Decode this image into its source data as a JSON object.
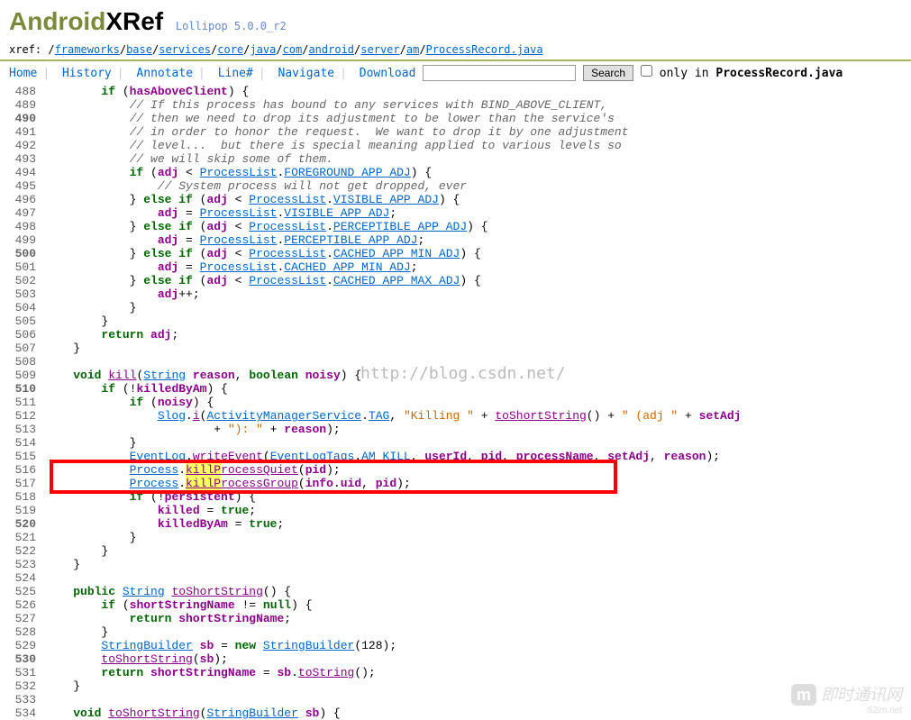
{
  "logo": {
    "android": "Android",
    "xref": "XRef",
    "version": "Lollipop 5.0.0_r2"
  },
  "breadcrumb": {
    "prefix": "xref: ",
    "parts": [
      "frameworks",
      "base",
      "services",
      "core",
      "java",
      "com",
      "android",
      "server",
      "am",
      "ProcessRecord.java"
    ]
  },
  "nav": {
    "home": "Home",
    "history": "History",
    "annotate": "Annotate",
    "line": "Line#",
    "navigate": "Navigate",
    "download": "Download",
    "search": "Search",
    "only_in": " only in ",
    "file": "ProcessRecord.java"
  },
  "watermark": "http://blog.csdn.net/",
  "bottom_wm": {
    "m": "m",
    "text": "即时通讯网",
    "sub": "52im.net"
  },
  "lines": [
    {
      "n": "488",
      "cls": "",
      "html": "        <span class='kw'>if</span> (<span class='var'>hasAboveClient</span>) {"
    },
    {
      "n": "489",
      "cls": "",
      "html": "            <span class='cmt'>// If this process has bound to any services with BIND_ABOVE_CLIENT,</span>"
    },
    {
      "n": "490",
      "cls": "curr",
      "html": "            <span class='cmt'>// then we need to drop its adjustment to be lower than the service's</span>"
    },
    {
      "n": "491",
      "cls": "",
      "html": "            <span class='cmt'>// in order to honor the request.  We want to drop it by one adjustment</span>"
    },
    {
      "n": "492",
      "cls": "",
      "html": "            <span class='cmt'>// level...  but there is special meaning applied to various levels so</span>"
    },
    {
      "n": "493",
      "cls": "",
      "html": "            <span class='cmt'>// we will skip some of them.</span>"
    },
    {
      "n": "494",
      "cls": "",
      "html": "            <span class='kw'>if</span> (<span class='var'>adj</span> &lt; <span class='type'>ProcessList</span>.<span class='type'>FOREGROUND_APP_ADJ</span>) {"
    },
    {
      "n": "495",
      "cls": "",
      "html": "                <span class='cmt'>// System process will not get dropped, ever</span>"
    },
    {
      "n": "496",
      "cls": "",
      "html": "            } <span class='kw'>else</span> <span class='kw'>if</span> (<span class='var'>adj</span> &lt; <span class='type'>ProcessList</span>.<span class='type'>VISIBLE_APP_ADJ</span>) {"
    },
    {
      "n": "497",
      "cls": "",
      "html": "                <span class='var'>adj</span> = <span class='type'>ProcessList</span>.<span class='type'>VISIBLE_APP_ADJ</span>;"
    },
    {
      "n": "498",
      "cls": "",
      "html": "            } <span class='kw'>else</span> <span class='kw'>if</span> (<span class='var'>adj</span> &lt; <span class='type'>ProcessList</span>.<span class='type'>PERCEPTIBLE_APP_ADJ</span>) {"
    },
    {
      "n": "499",
      "cls": "",
      "html": "                <span class='var'>adj</span> = <span class='type'>ProcessList</span>.<span class='type'>PERCEPTIBLE_APP_ADJ</span>;"
    },
    {
      "n": "500",
      "cls": "curr",
      "html": "            } <span class='kw'>else</span> <span class='kw'>if</span> (<span class='var'>adj</span> &lt; <span class='type'>ProcessList</span>.<span class='type'>CACHED_APP_MIN_ADJ</span>) {"
    },
    {
      "n": "501",
      "cls": "",
      "html": "                <span class='var'>adj</span> = <span class='type'>ProcessList</span>.<span class='type'>CACHED_APP_MIN_ADJ</span>;"
    },
    {
      "n": "502",
      "cls": "",
      "html": "            } <span class='kw'>else</span> <span class='kw'>if</span> (<span class='var'>adj</span> &lt; <span class='type'>ProcessList</span>.<span class='type'>CACHED_APP_MAX_ADJ</span>) {"
    },
    {
      "n": "503",
      "cls": "",
      "html": "                <span class='var'>adj</span>++;"
    },
    {
      "n": "504",
      "cls": "",
      "html": "            }"
    },
    {
      "n": "505",
      "cls": "",
      "html": "        }"
    },
    {
      "n": "506",
      "cls": "",
      "html": "        <span class='kw'>return</span> <span class='var'>adj</span>;"
    },
    {
      "n": "507",
      "cls": "",
      "html": "    }"
    },
    {
      "n": "508",
      "cls": "",
      "html": ""
    },
    {
      "n": "509",
      "cls": "",
      "html": "    <span class='kw'>void</span> <span class='fn'>kill</span>(<span class='type'>String</span> <span class='var'>reason</span>, <span class='kw'>boolean</span> <span class='var'>noisy</span>) {"
    },
    {
      "n": "510",
      "cls": "curr",
      "html": "        <span class='kw'>if</span> (!<span class='var'>killedByAm</span>) {"
    },
    {
      "n": "511",
      "cls": "",
      "html": "            <span class='kw'>if</span> (<span class='var'>noisy</span>) {"
    },
    {
      "n": "512",
      "cls": "",
      "html": "                <span class='type'>Slog</span>.<span class='fn'>i</span>(<span class='type'>ActivityManagerService</span>.<span class='type'>TAG</span>, <span class='str'>\"Killing \"</span> + <span class='fn'>toShortString</span>() + <span class='str'>\" (adj \"</span> + <span class='var'>setAdj</span>"
    },
    {
      "n": "513",
      "cls": "",
      "html": "                        + <span class='str'>\"): \"</span> + <span class='var'>reason</span>);"
    },
    {
      "n": "514",
      "cls": "",
      "html": "            }"
    },
    {
      "n": "515",
      "cls": "",
      "html": "            <span class='type'>EventLog</span>.<span class='fn'>writeEvent</span>(<span class='type'>EventLogTags</span>.<span class='type'>AM_KILL</span>, <span class='var'>userId</span>, <span class='var'>pid</span>, <span class='var'>processName</span>, <span class='var'>setAdj</span>, <span class='var'>reason</span>);"
    },
    {
      "n": "516",
      "cls": "",
      "html": "            <span class='type'>Process</span>.<span class='fn'><span class='hl'>killP</span>rocessQuiet</span>(<span class='var'>pid</span>);"
    },
    {
      "n": "517",
      "cls": "",
      "html": "            <span class='type'>Process</span>.<span class='fn'><span class='hl'>killP</span>rocessGroup</span>(<span class='var'>info</span>.<span class='var'>uid</span>, <span class='var'>pid</span>);"
    },
    {
      "n": "518",
      "cls": "",
      "html": "            <span class='kw'>if</span> (!<span class='var'>persistent</span>) {"
    },
    {
      "n": "519",
      "cls": "",
      "html": "                <span class='var'>killed</span> = <span class='kw'>true</span>;"
    },
    {
      "n": "520",
      "cls": "curr",
      "html": "                <span class='var'>killedByAm</span> = <span class='kw'>true</span>;"
    },
    {
      "n": "521",
      "cls": "",
      "html": "            }"
    },
    {
      "n": "522",
      "cls": "",
      "html": "        }"
    },
    {
      "n": "523",
      "cls": "",
      "html": "    }"
    },
    {
      "n": "524",
      "cls": "",
      "html": ""
    },
    {
      "n": "525",
      "cls": "",
      "html": "    <span class='kw'>public</span> <span class='type'>String</span> <span class='fn'>toShortString</span>() {"
    },
    {
      "n": "526",
      "cls": "",
      "html": "        <span class='kw'>if</span> (<span class='var'>shortStringName</span> != <span class='kw'>null</span>) {"
    },
    {
      "n": "527",
      "cls": "",
      "html": "            <span class='kw'>return</span> <span class='var'>shortStringName</span>;"
    },
    {
      "n": "528",
      "cls": "",
      "html": "        }"
    },
    {
      "n": "529",
      "cls": "",
      "html": "        <span class='type'>StringBuilder</span> <span class='var'>sb</span> = <span class='kw'>new</span> <span class='type'>StringBuilder</span>(128);"
    },
    {
      "n": "530",
      "cls": "curr",
      "html": "        <span class='fn'>toShortString</span>(<span class='var'>sb</span>);"
    },
    {
      "n": "531",
      "cls": "",
      "html": "        <span class='kw'>return</span> <span class='var'>shortStringName</span> = <span class='var'>sb</span>.<span class='fn'>toString</span>();"
    },
    {
      "n": "532",
      "cls": "",
      "html": "    }"
    },
    {
      "n": "533",
      "cls": "",
      "html": ""
    },
    {
      "n": "534",
      "cls": "",
      "html": "    <span class='kw'>void</span> <span class='fn'>toShortString</span>(<span class='type'>StringBuilder</span> <span class='var'>sb</span>) {"
    }
  ],
  "redbox": {
    "top_line": 28,
    "height_lines": 2
  }
}
